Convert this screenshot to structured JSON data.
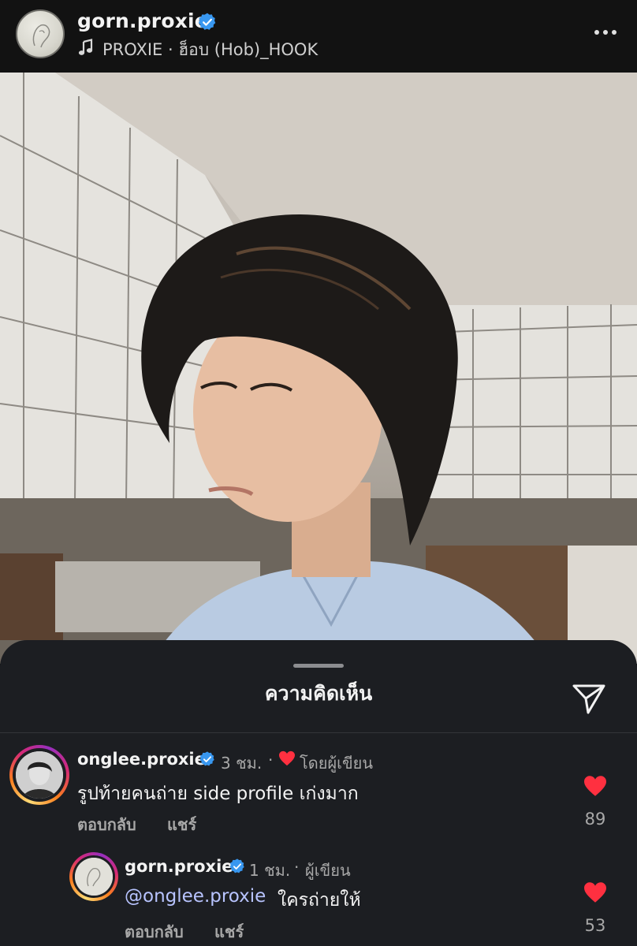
{
  "header": {
    "username": "gorn.proxie",
    "song": "PROXIE · ฮ็อบ (Hob)_HOOK"
  },
  "sheet": {
    "title": "ความคิดเห็น"
  },
  "comments": [
    {
      "username": "onglee.proxie",
      "time": "3 ชม.",
      "separator": "·",
      "author_badge": "โดยผู้เขียน",
      "text": "รูปท้ายคนถ่าย side profile เก่งมาก",
      "reply_label": "ตอบกลับ",
      "share_label": "แชร์",
      "likes": "89"
    },
    {
      "username": "gorn.proxie",
      "time": "1 ชม.",
      "separator": "·",
      "author_badge": "ผู้เขียน",
      "mention": "@onglee.proxie",
      "text": "ใครถ่ายให้",
      "reply_label": "ตอบกลับ",
      "share_label": "แชร์",
      "likes": "53"
    }
  ],
  "colors": {
    "background": "#000000",
    "sheet": "#1c1e22",
    "verified": "#3897f0",
    "like": "#ff3040",
    "mention": "#b8c4ff"
  },
  "icons": [
    "music-icon",
    "verified-icon",
    "more-icon",
    "send-icon",
    "heart-icon"
  ]
}
